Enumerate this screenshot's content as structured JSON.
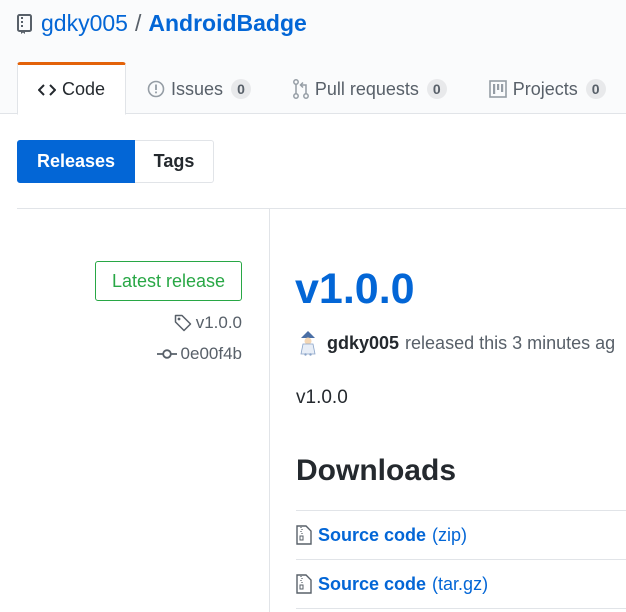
{
  "repo": {
    "owner": "gdky005",
    "separator": "/",
    "name": "AndroidBadge"
  },
  "nav": {
    "tabs": [
      {
        "label": "Code",
        "icon": "code-icon",
        "selected": true
      },
      {
        "label": "Issues",
        "icon": "issue-opened-icon",
        "count": "0"
      },
      {
        "label": "Pull requests",
        "icon": "git-pull-request-icon",
        "count": "0"
      },
      {
        "label": "Projects",
        "icon": "project-icon",
        "count": "0"
      }
    ]
  },
  "subnav": {
    "releases_label": "Releases",
    "tags_label": "Tags"
  },
  "release": {
    "latest_label": "Latest release",
    "tag": "v1.0.0",
    "commit": "0e00f4b",
    "title": "v1.0.0",
    "author": "gdky005",
    "byline_text": "released this 3 minutes ag",
    "body": "v1.0.0",
    "downloads_heading": "Downloads",
    "assets": [
      {
        "name": "Source code",
        "format": "(zip)",
        "icon": "file-zip-icon"
      },
      {
        "name": "Source code",
        "format": "(tar.gz)",
        "icon": "file-zip-icon"
      }
    ]
  },
  "colors": {
    "link": "#0366d6",
    "accent_tab": "#e36209",
    "latest_green": "#28a745"
  }
}
